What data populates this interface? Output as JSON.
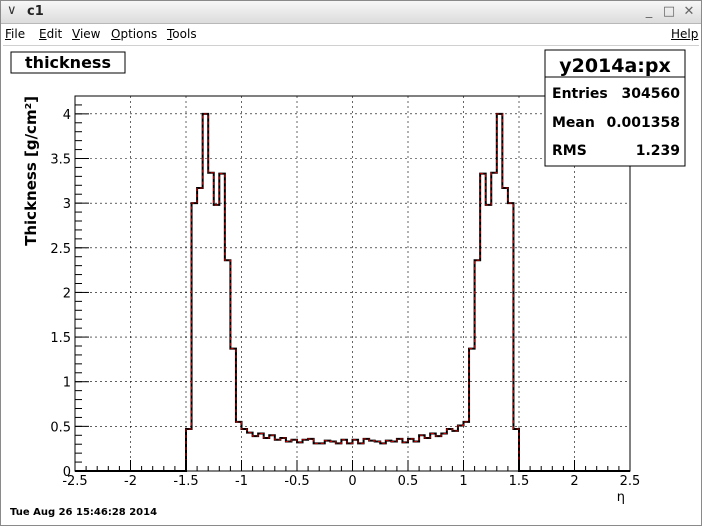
{
  "window": {
    "title": "c1",
    "help": "Help",
    "menus": [
      {
        "u": "F",
        "rest": "ile"
      },
      {
        "u": "E",
        "rest": "dit"
      },
      {
        "u": "V",
        "rest": "iew"
      },
      {
        "u": "O",
        "rest": "ptions"
      },
      {
        "u": "T",
        "rest": "ools"
      }
    ]
  },
  "canvas": {
    "title_box": "thickness",
    "stats": {
      "name": "y2014a:px",
      "rows": [
        {
          "label": "Entries",
          "value": "304560"
        },
        {
          "label": "Mean",
          "value": "0.001358"
        },
        {
          "label": "RMS",
          "value": "1.239"
        }
      ]
    },
    "timestamp": "Tue Aug 26 15:46:28 2014"
  },
  "chart_data": {
    "type": "step-histogram",
    "xlabel": "η",
    "ylabel": "Thickness [g/cm²]",
    "xlim": [
      -2.5,
      2.5
    ],
    "ylim": [
      0,
      4.2
    ],
    "xticks": [
      "-2.5",
      "-2",
      "-1.5",
      "-1",
      "-0.5",
      "0",
      "0.5",
      "1",
      "1.5",
      "2",
      "2.5"
    ],
    "yticks": [
      "0",
      "0.5",
      "1",
      "1.5",
      "2",
      "2.5",
      "3",
      "3.5",
      "4"
    ],
    "grid": true,
    "line_color": "#000000",
    "dash_color": "#cc0000",
    "bin_width": 0.05,
    "x_start": -2.5,
    "values": [
      0,
      0,
      0,
      0,
      0,
      0,
      0,
      0,
      0,
      0,
      0,
      0,
      0,
      0,
      0,
      0,
      0,
      0,
      0,
      0,
      0.47,
      3.0,
      3.17,
      4.0,
      3.34,
      2.98,
      3.33,
      2.36,
      1.37,
      0.55,
      0.47,
      0.43,
      0.39,
      0.42,
      0.37,
      0.4,
      0.35,
      0.37,
      0.33,
      0.35,
      0.32,
      0.35,
      0.36,
      0.31,
      0.31,
      0.34,
      0.33,
      0.31,
      0.35,
      0.31,
      0.35,
      0.31,
      0.36,
      0.34,
      0.33,
      0.31,
      0.34,
      0.33,
      0.36,
      0.32,
      0.36,
      0.33,
      0.4,
      0.37,
      0.42,
      0.39,
      0.42,
      0.47,
      0.45,
      0.51,
      0.55,
      1.37,
      2.36,
      3.33,
      2.98,
      3.34,
      4.0,
      3.17,
      3.0,
      0.47,
      0,
      0,
      0,
      0,
      0,
      0,
      0,
      0,
      0,
      0,
      0,
      0,
      0,
      0,
      0,
      0,
      0,
      0,
      0,
      0
    ]
  }
}
